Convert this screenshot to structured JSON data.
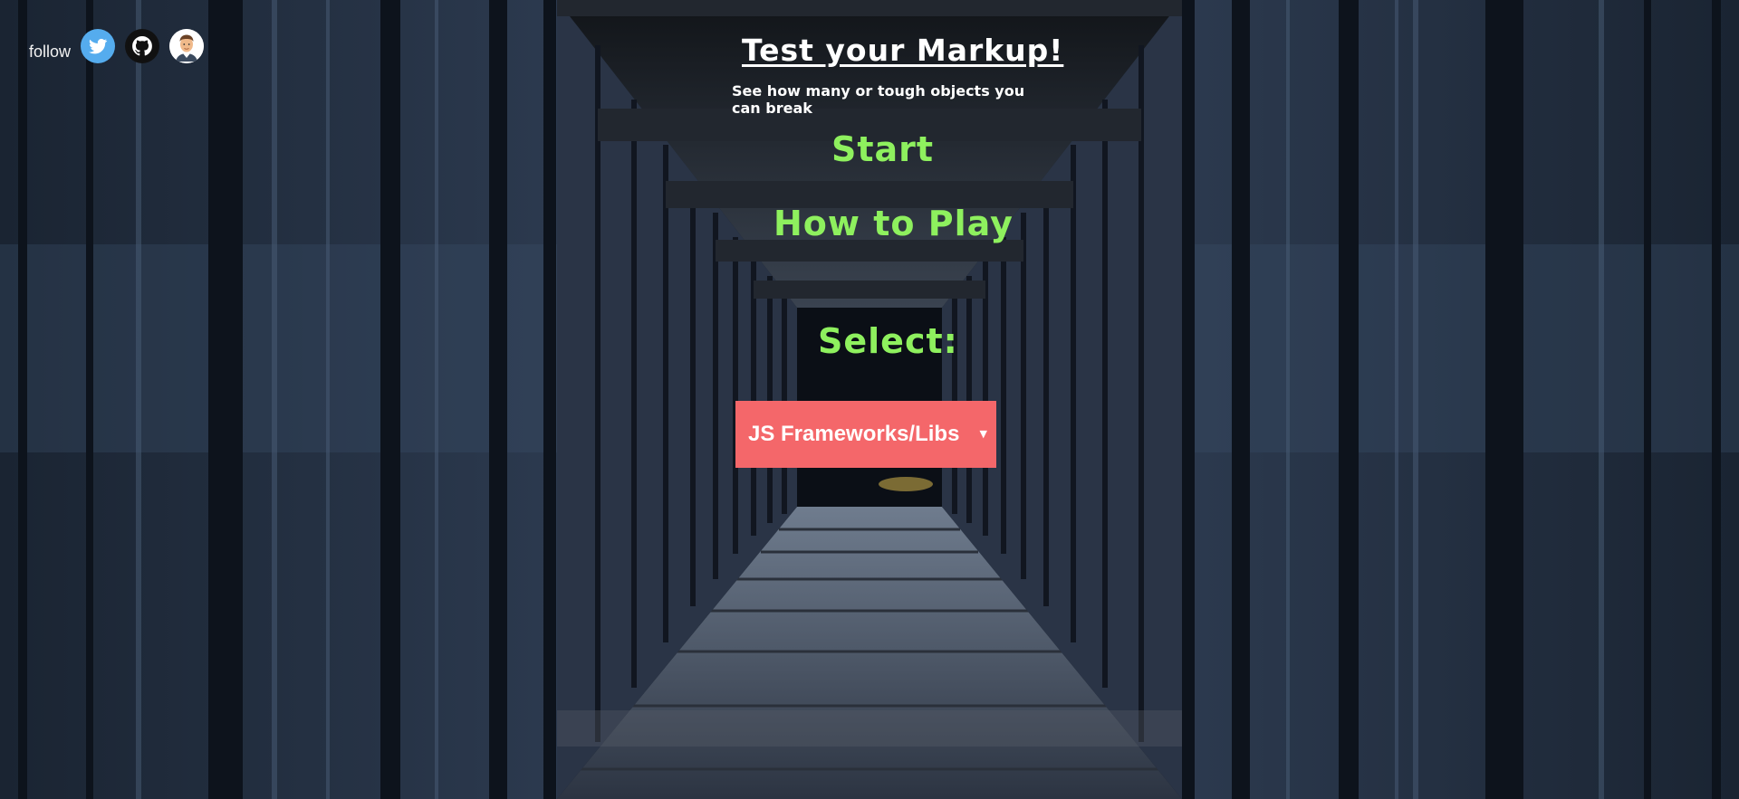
{
  "follow": {
    "label": "follow",
    "links": [
      {
        "name": "twitter-icon",
        "color": "#55acee"
      },
      {
        "name": "github-icon",
        "color": "#111111"
      },
      {
        "name": "avatar-icon",
        "color": "#ffffff"
      }
    ]
  },
  "header": {
    "title": "Test your Markup!",
    "subtitle": "See how many or tough objects you can break"
  },
  "menu": {
    "start_label": "Start",
    "how_to_play_label": "How to Play",
    "select_label": "Select:"
  },
  "category_select": {
    "selected": "JS Frameworks/Libs",
    "arrow": "▼"
  },
  "colors": {
    "accent_green": "#8ef05e",
    "dropdown_bg": "#f4676a"
  }
}
